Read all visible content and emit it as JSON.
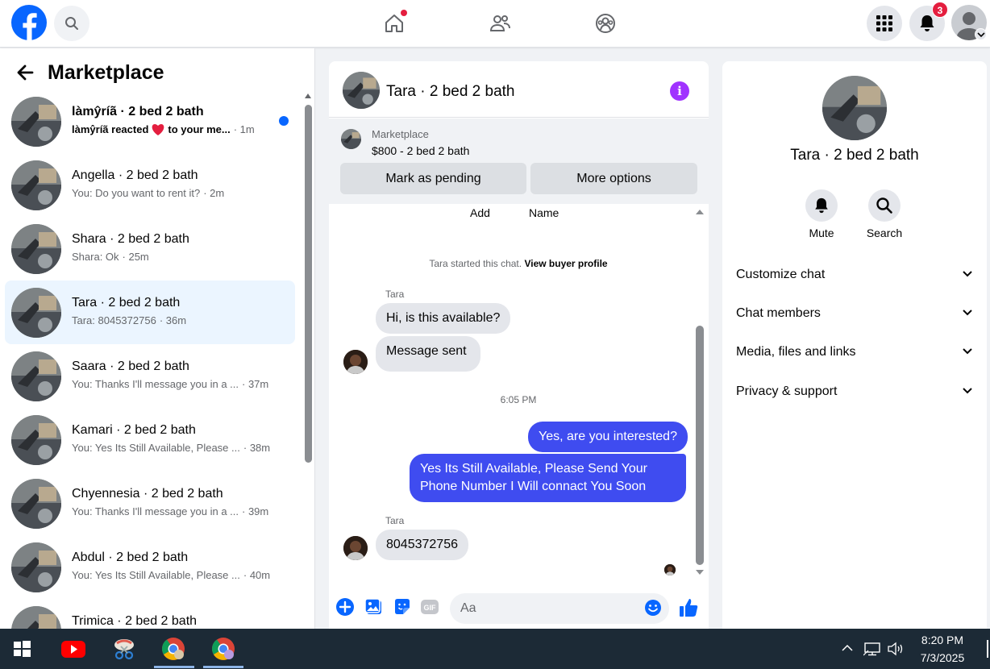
{
  "topnav": {
    "notification_count": "3"
  },
  "sidebar": {
    "title": "Marketplace",
    "conversations": [
      {
        "name": "làmŷríã · 2 bed 2 bath",
        "preview": "làmŷríã reacted",
        "preview_suffix": "to your me...",
        "time": "· 1m",
        "unread": true
      },
      {
        "name": "Angella · 2 bed 2 bath",
        "preview": "You: Do you want to rent it?",
        "time": "· 2m"
      },
      {
        "name": "Shara · 2 bed 2 bath",
        "preview": "Shara: Ok",
        "time": "· 25m"
      },
      {
        "name": "Tara · 2 bed 2 bath",
        "preview": "Tara: 8045372756",
        "time": "· 36m",
        "active": true
      },
      {
        "name": "Saara · 2 bed 2 bath",
        "preview": "You: Thanks I'll message you in a ...",
        "time": "· 37m"
      },
      {
        "name": "Kamari · 2 bed 2 bath",
        "preview": "You: Yes Its Still Available, Please ...",
        "time": "· 38m"
      },
      {
        "name": "Chyennesia · 2 bed 2 bath",
        "preview": "You: Thanks I'll message you in a ...",
        "time": "· 39m"
      },
      {
        "name": "Abdul · 2 bed 2 bath",
        "preview": "You: Yes Its Still Available, Please ...",
        "time": "· 40m"
      },
      {
        "name": "Trimica · 2 bed 2 bath",
        "preview": "",
        "time": ""
      }
    ]
  },
  "chat": {
    "title": "Tara · 2 bed 2 bath",
    "listing": {
      "label": "Marketplace",
      "price": "$800 - 2 bed 2 bath",
      "mark_pending_label": "Mark as pending",
      "more_options_label": "More options"
    },
    "cut_header": {
      "add": "Add",
      "name": "Name"
    },
    "system_message": "Tara started this chat.",
    "system_link": "View buyer profile",
    "sender_1": "Tara",
    "msg_1": "Hi, is this available?",
    "msg_2": "Message sent",
    "timestamp": "6:05 PM",
    "out_1": "Yes, are you interested?",
    "out_2_line1": "Yes Its Still Available, Please Send Your",
    "out_2_line2": "Phone Number I Will connact You Soon",
    "sender_2": "Tara",
    "msg_3": "8045372756",
    "composer_placeholder": "Aa",
    "gif_label": "GIF"
  },
  "rpanel": {
    "name": "Tara · 2 bed 2 bath",
    "mute_label": "Mute",
    "search_label": "Search",
    "sections": [
      "Customize chat",
      "Chat members",
      "Media, files and links",
      "Privacy & support"
    ]
  },
  "taskbar": {
    "time": "8:20 PM",
    "date": "7/3/2025"
  },
  "colors": {
    "fb_blue": "#0866ff",
    "outgoing_bubble": "#3f4cf0",
    "info_purple": "#a033ff",
    "badge_red": "#e41e3f"
  }
}
